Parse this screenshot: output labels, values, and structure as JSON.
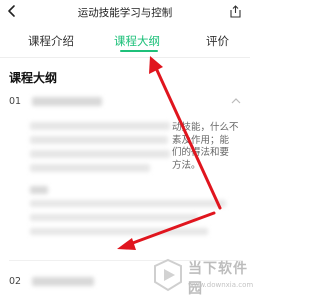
{
  "header": {
    "title": "运动技能学习与控制"
  },
  "tabs": [
    {
      "label": "课程介绍",
      "active": false
    },
    {
      "label": "课程大纲",
      "active": true
    },
    {
      "label": "评价",
      "active": false
    }
  ],
  "section_title": "课程大纲",
  "chapters": [
    {
      "number": "01",
      "expanded": true
    },
    {
      "number": "02",
      "expanded": false
    }
  ],
  "chapter_body_lines": [
    "动技能，什么不",
    "素及作用；能",
    "们的得法和要",
    "方法。"
  ],
  "watermark": {
    "main": "当下软件园",
    "url": "www.downxia.com"
  },
  "colors": {
    "accent": "#1ec07a",
    "arrow": "#e0151e"
  }
}
